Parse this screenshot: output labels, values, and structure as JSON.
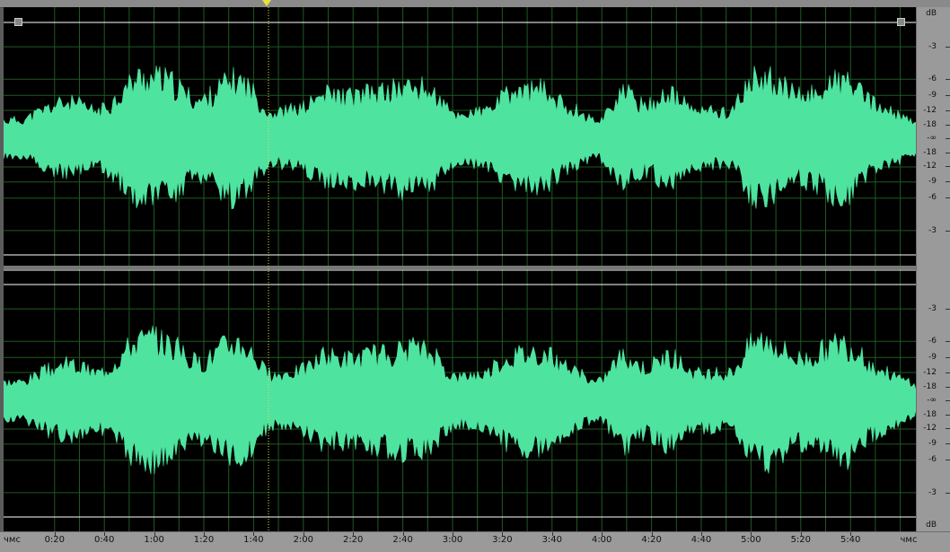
{
  "editor": {
    "ruler": {
      "start_label": "чмс",
      "end_label": "чмс",
      "time_labels": [
        "0:20",
        "0:40",
        "1:00",
        "1:20",
        "1:40",
        "2:00",
        "2:20",
        "2:40",
        "3:00",
        "3:20",
        "3:40",
        "4:00",
        "4:20",
        "4:40",
        "5:00",
        "5:20",
        "5:40"
      ]
    },
    "db_scale": {
      "unit": "dB",
      "channel1_labels": [
        "-3",
        "-6",
        "-9",
        "-12",
        "-18",
        "-∞",
        "-18",
        "-12",
        "-9",
        "-6",
        "-3"
      ],
      "channel2_labels": [
        "-3",
        "-6",
        "-9",
        "-12",
        "-18",
        "-∞",
        "-18",
        "-12",
        "-9",
        "-6",
        "-3"
      ]
    },
    "playhead_time": "1:46",
    "colors": {
      "waveform": "#4fe3a0",
      "background": "#000000",
      "grid": "#1f5a1f",
      "playhead": "#e8e13a",
      "boundary": "#ffffff"
    }
  }
}
